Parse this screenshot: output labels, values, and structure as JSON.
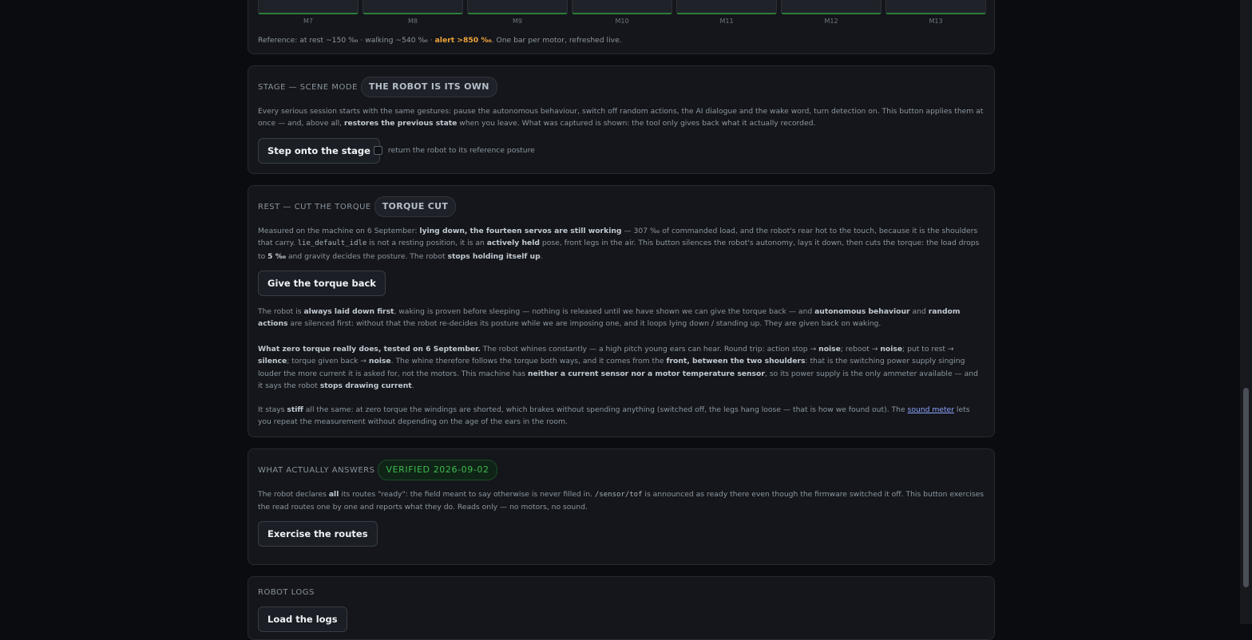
{
  "motors": {
    "labels": [
      "M7",
      "M8",
      "M9",
      "M10",
      "M11",
      "M12",
      "M13"
    ],
    "reference_prefix": "Reference: at rest ~150 ‰ · walking ~540 ‰ · ",
    "reference_alert": "alert >850 ‰",
    "reference_suffix": ". One bar per motor, refreshed live.",
    "alert_color": "#f0a43a",
    "bar_color": "#2e7d3a"
  },
  "stage": {
    "title": "STAGE — SCENE MODE",
    "badge": "THE ROBOT IS ITS OWN",
    "p1": "Every serious session starts with the same gestures: pause the autonomous behaviour, switch off random actions, the AI dialogue and the wake word, turn detection on. This button applies them at once — and, above all, ",
    "p1_bold": "restores the previous state",
    "p1_end": " when you leave. What was captured is shown: the tool only gives back what it actually recorded.",
    "button": "Step onto the stage",
    "checkbox_label": "return the robot to its reference posture"
  },
  "rest": {
    "title": "REST — CUT THE TORQUE",
    "badge": "TORQUE CUT",
    "p1_a": "Measured on the machine on 6 September: ",
    "p1_b": "lying down, the fourteen servos are still working",
    "p1_c": " — 307 ‰ of commanded load, and the robot's rear hot to the touch, because it is the shoulders that carry. ",
    "p1_code": "lie_default_idle",
    "p1_d": " is not a resting position, it is an ",
    "p1_e": "actively held",
    "p1_f": " pose, front legs in the air. This button silences the robot's autonomy, lays it down, then cuts the torque: the load drops to ",
    "p1_g": "5 ‰",
    "p1_h": " and gravity decides the posture. The robot ",
    "p1_i": "stops holding itself up",
    "p1_j": ".",
    "button": "Give the torque back",
    "p2_a": "The robot is ",
    "p2_b": "always laid down first",
    "p2_c": ", waking is proven before sleeping — nothing is released until we have shown we can give the torque back — and ",
    "p2_d": "autonomous behaviour",
    "p2_e": " and ",
    "p2_f": "random actions",
    "p2_g": " are silenced first: without that the robot re-decides its posture while we are imposing one, and it loops lying down / standing up. They are given back on waking.",
    "p3_a": "What zero torque really does, tested on 6 September.",
    "p3_b": " The robot whines constantly — a high pitch young ears can hear. Round trip: action stop → ",
    "p3_c": "noise",
    "p3_d": "; reboot → ",
    "p3_e": "noise",
    "p3_f": "; put to rest → ",
    "p3_g": "silence",
    "p3_h": "; torque given back → ",
    "p3_i": "noise",
    "p3_j": ". The whine therefore follows the torque both ways, and it comes from the ",
    "p3_k": "front, between the two shoulders",
    "p3_l": ": that is the switching power supply singing louder the more current it is asked for, not the motors. This machine has ",
    "p3_m": "neither a current sensor nor a motor temperature sensor",
    "p3_n": ", so its power supply is the only ammeter available — and it says the robot ",
    "p3_o": "stops drawing current",
    "p3_p": ".",
    "p4_a": "It stays ",
    "p4_b": "stiff",
    "p4_c": " all the same: at zero torque the windings are shorted, which brakes without spending anything (switched off, the legs hang loose — that is how we found out). The ",
    "p4_link": "sound meter",
    "p4_d": " lets you repeat the measurement without depending on the age of the ears in the room."
  },
  "routes": {
    "title": "WHAT ACTUALLY ANSWERS",
    "badge": "VERIFIED 2026-09-02",
    "p1_a": "The robot declares ",
    "p1_b": "all",
    "p1_c": " its routes \"ready\": the field meant to say otherwise is never filled in. ",
    "p1_code": "/sensor/tof",
    "p1_d": " is announced as ready there even though the firmware switched it off. This button exercises the read routes one by one and reports what they do. Reads only — no motors, no sound.",
    "button": "Exercise the routes"
  },
  "logs": {
    "title": "ROBOT LOGS",
    "button": "Load the logs"
  }
}
